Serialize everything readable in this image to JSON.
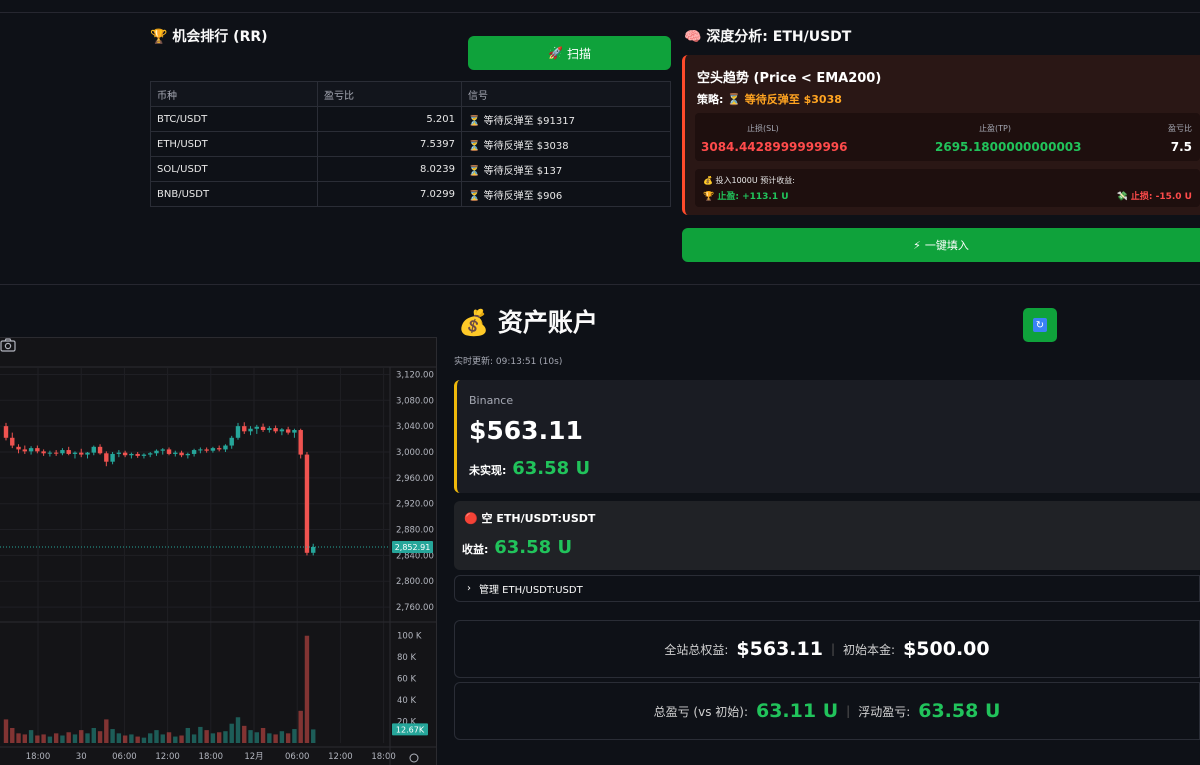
{
  "ranking": {
    "icon": "trophy-icon",
    "title": "机会排行 (RR)",
    "scan_label": "扫描",
    "columns": [
      "币种",
      "盈亏比",
      "信号"
    ],
    "rows": [
      {
        "coin": "BTC/USDT",
        "rr": "5.201",
        "signal": "⏳ 等待反弹至 $91317"
      },
      {
        "coin": "ETH/USDT",
        "rr": "7.5397",
        "signal": "⏳ 等待反弹至 $3038"
      },
      {
        "coin": "SOL/USDT",
        "rr": "8.0239",
        "signal": "⏳ 等待反弹至 $137"
      },
      {
        "coin": "BNB/USDT",
        "rr": "7.0299",
        "signal": "⏳ 等待反弹至 $906"
      }
    ]
  },
  "deep": {
    "title": "深度分析: ETH/USDT",
    "trend": "空头趋势 (Price < EMA200)",
    "strategy_label": "策略:",
    "strategy_value": "⏳ 等待反弹至 $3038",
    "sl_label": "止损(SL)",
    "sl_value": "3084.4428999999996",
    "tp_label": "止盈(TP)",
    "tp_value": "2695.1800000000003",
    "rr_label": "盈亏比",
    "rr_value": "7.5",
    "est_label": "💰 投入1000U 预计收益:",
    "tp_result": "🏆 止盈: +113.1 U",
    "sl_result": "💸 止损: -15.0 U",
    "fill_label": "一键填入"
  },
  "chart": {
    "y_ticks": [
      "3,120.00",
      "3,080.00",
      "3,040.00",
      "3,000.00",
      "2,960.00",
      "2,920.00",
      "2,880.00",
      "2,840.00",
      "2,800.00",
      "2,760.00"
    ],
    "current_price": "2,852.91",
    "vol_ticks": [
      "100 K",
      "80 K",
      "60 K",
      "40 K",
      "20 K"
    ],
    "current_vol": "12.67K",
    "x_ticks": [
      "18:00",
      "30",
      "06:00",
      "12:00",
      "18:00",
      "12月",
      "06:00",
      "12:00",
      "18:00"
    ]
  },
  "chart_data": {
    "type": "candlestick",
    "title": "",
    "ylim": [
      2740,
      3130
    ],
    "vol_ylim": [
      0,
      110000
    ],
    "x": [
      "18:00",
      "30",
      "06:00",
      "12:00",
      "18:00",
      "12月",
      "06:00",
      "12:00",
      "18:00"
    ],
    "candles": [
      [
        3040,
        3045,
        3018,
        3022
      ],
      [
        3022,
        3030,
        3006,
        3010
      ],
      [
        3008,
        3012,
        2998,
        3004
      ],
      [
        3004,
        3010,
        2997,
        3001
      ],
      [
        3001,
        3009,
        2996,
        3006
      ],
      [
        3006,
        3010,
        2998,
        3001
      ],
      [
        3001,
        3004,
        2994,
        2998
      ],
      [
        2998,
        3002,
        2993,
        2999
      ],
      [
        2999,
        3003,
        2994,
        2998
      ],
      [
        2998,
        3006,
        2995,
        3003
      ],
      [
        3003,
        3008,
        2995,
        2997
      ],
      [
        2997,
        3001,
        2990,
        2999
      ],
      [
        2999,
        3005,
        2992,
        2996
      ],
      [
        2996,
        3000,
        2990,
        2999
      ],
      [
        2999,
        3010,
        2995,
        3008
      ],
      [
        3008,
        3012,
        2996,
        2998
      ],
      [
        2998,
        3001,
        2978,
        2985
      ],
      [
        2985,
        3000,
        2981,
        2997
      ],
      [
        2997,
        3003,
        2992,
        2999
      ],
      [
        2999,
        3002,
        2992,
        2995
      ],
      [
        2995,
        2999,
        2990,
        2997
      ],
      [
        2997,
        3000,
        2991,
        2994
      ],
      [
        2994,
        2998,
        2990,
        2996
      ],
      [
        2996,
        3000,
        2992,
        2998
      ],
      [
        2998,
        3004,
        2994,
        3002
      ],
      [
        3002,
        3006,
        2996,
        3004
      ],
      [
        3004,
        3007,
        2995,
        2997
      ],
      [
        2997,
        3002,
        2993,
        2999
      ],
      [
        2999,
        3002,
        2992,
        2995
      ],
      [
        2995,
        2999,
        2990,
        2997
      ],
      [
        2997,
        3005,
        2993,
        3003
      ],
      [
        3003,
        3007,
        2998,
        3004
      ],
      [
        3004,
        3007,
        2999,
        3002
      ],
      [
        3002,
        3008,
        2999,
        3006
      ],
      [
        3006,
        3010,
        3001,
        3004
      ],
      [
        3004,
        3012,
        3000,
        3010
      ],
      [
        3010,
        3025,
        3005,
        3022
      ],
      [
        3022,
        3045,
        3019,
        3040
      ],
      [
        3040,
        3046,
        3028,
        3032
      ],
      [
        3032,
        3040,
        3026,
        3036
      ],
      [
        3036,
        3042,
        3028,
        3039
      ],
      [
        3039,
        3044,
        3031,
        3034
      ],
      [
        3034,
        3040,
        3030,
        3037
      ],
      [
        3037,
        3041,
        3029,
        3032
      ],
      [
        3032,
        3037,
        3026,
        3035
      ],
      [
        3035,
        3039,
        3027,
        3030
      ],
      [
        3030,
        3036,
        3022,
        3034
      ],
      [
        3034,
        3036,
        2990,
        2996
      ],
      [
        2996,
        3000,
        2840,
        2844
      ],
      [
        2844,
        2858,
        2840,
        2853
      ]
    ],
    "volume": [
      22000,
      14000,
      9000,
      8000,
      12000,
      7000,
      8000,
      6000,
      9000,
      7000,
      10000,
      8000,
      12000,
      9000,
      14000,
      11000,
      22000,
      13000,
      9000,
      7000,
      8000,
      6000,
      5000,
      9000,
      12000,
      8000,
      10000,
      6000,
      7000,
      14000,
      8000,
      15000,
      12000,
      9000,
      10000,
      11000,
      18000,
      24000,
      16000,
      12000,
      10000,
      14000,
      9000,
      8000,
      11000,
      9000,
      13000,
      30000,
      100000,
      12670
    ]
  },
  "account": {
    "icon": "money-bag-icon",
    "title": "资产账户",
    "refresh_icon": "refresh-icon",
    "update_text": "实时更新: 09:13:51 (10s)",
    "exchange": "Binance",
    "balance": "$563.11",
    "unrealized_label": "未实现:",
    "unrealized_value": "63.58 U",
    "position_title": "空 ETH/USDT:USDT",
    "position_pnl_label": "收益:",
    "position_pnl_value": "63.58 U",
    "manage_label": "管理 ETH/USDT:USDT",
    "total_equity_label": "全站总权益:",
    "total_equity_value": "$563.11",
    "initial_label": "初始本金:",
    "initial_value": "$500.00",
    "total_pnl_label": "总盈亏 (vs 初始):",
    "total_pnl_value": "63.11 U",
    "float_pnl_label": "浮动盈亏:",
    "float_pnl_value": "63.58 U"
  },
  "colors": {
    "up": "#26a69a",
    "down": "#ef5350",
    "accent_green": "#21c35b",
    "button_green": "#0fa23b",
    "warning": "#ffa421",
    "binance": "#f0b90b"
  }
}
